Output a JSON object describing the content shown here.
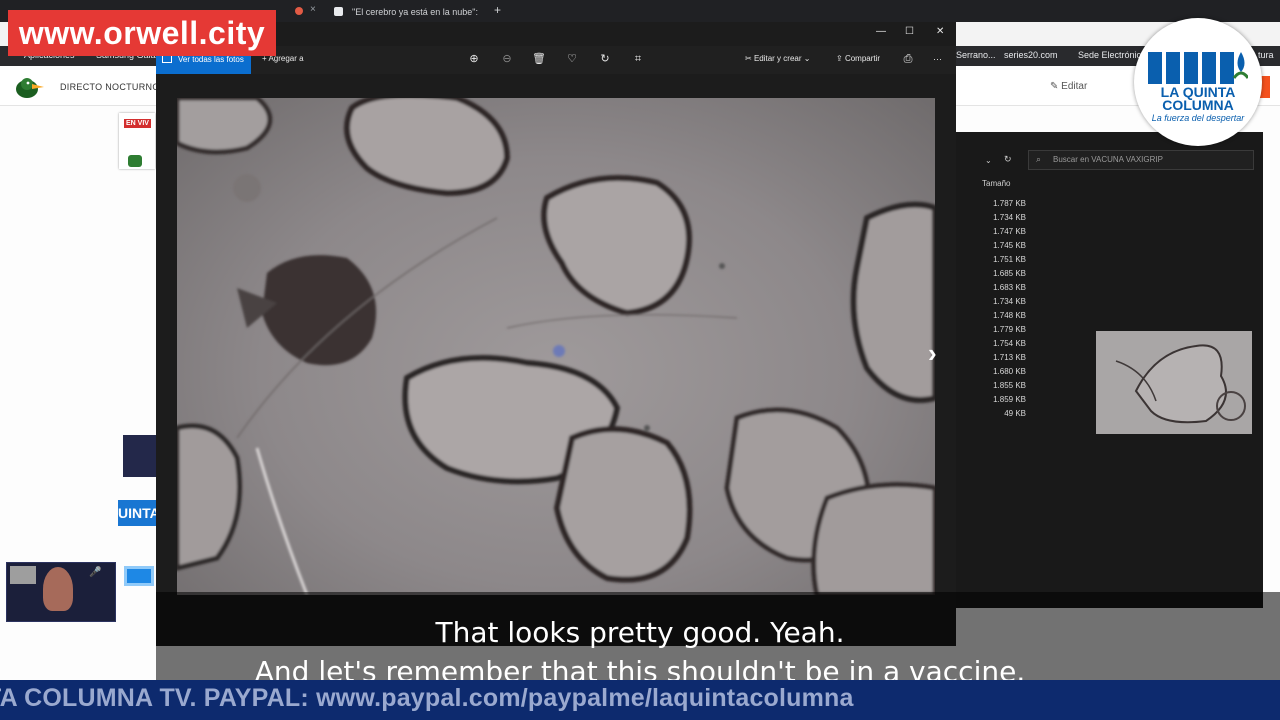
{
  "browser": {
    "tabs": [
      {
        "label": "\"El cerebro ya está en la nube\": "
      }
    ],
    "new_tab_icon": "plus-icon",
    "bookmarks": [
      "Aplicaciones",
      "Samsung Galaxy",
      "Serrano...",
      "series20.com",
      "Sede Electrónica",
      "tura"
    ]
  },
  "website": {
    "title": "DIRECTO NOCTURNO D",
    "edit_label": "Editar",
    "live_badge": "EN VIV",
    "quinta_tag": "UINTA"
  },
  "photos_viewer": {
    "see_all_label": "Ver todas las fotos",
    "add_to_label": "Agregar a",
    "edit_create_label": "Editar y crear",
    "share_label": "Compartir",
    "more_label": "···",
    "toolbar_icons": [
      "zoom-in-icon",
      "zoom-out-icon",
      "delete-icon",
      "heart-icon",
      "rotate-icon",
      "crop-icon"
    ]
  },
  "explorer": {
    "search_placeholder": "Buscar en VACUNA VAXIGRIP",
    "size_header": "Tamaño",
    "sizes": [
      "1.787 KB",
      "1.734 KB",
      "1.747 KB",
      "1.745 KB",
      "1.751 KB",
      "1.685 KB",
      "1.683 KB",
      "1.734 KB",
      "1.748 KB",
      "1.779 KB",
      "1.754 KB",
      "1.713 KB",
      "1.680 KB",
      "1.855 KB",
      "1.859 KB",
      "49 KB"
    ]
  },
  "watermark": {
    "text": "www.orwell.city"
  },
  "logo": {
    "line1": "LA QUINTA",
    "line2": "COLUMNA",
    "tagline": "La fuerza del despertar"
  },
  "subtitles": {
    "line1": "That looks pretty good. Yeah.",
    "line2": "And let's remember that this shouldn't be in a vaccine."
  },
  "ticker": {
    "text": "TA COLUMNA TV. PAYPAL: www.paypal.com/paypalme/laquintacolumna"
  },
  "colors": {
    "watermark_red": "#e53935",
    "ticker_blue": "#0d2a6e",
    "photos_accent": "#0b6ecf",
    "logo_blue": "#0a5fae"
  }
}
